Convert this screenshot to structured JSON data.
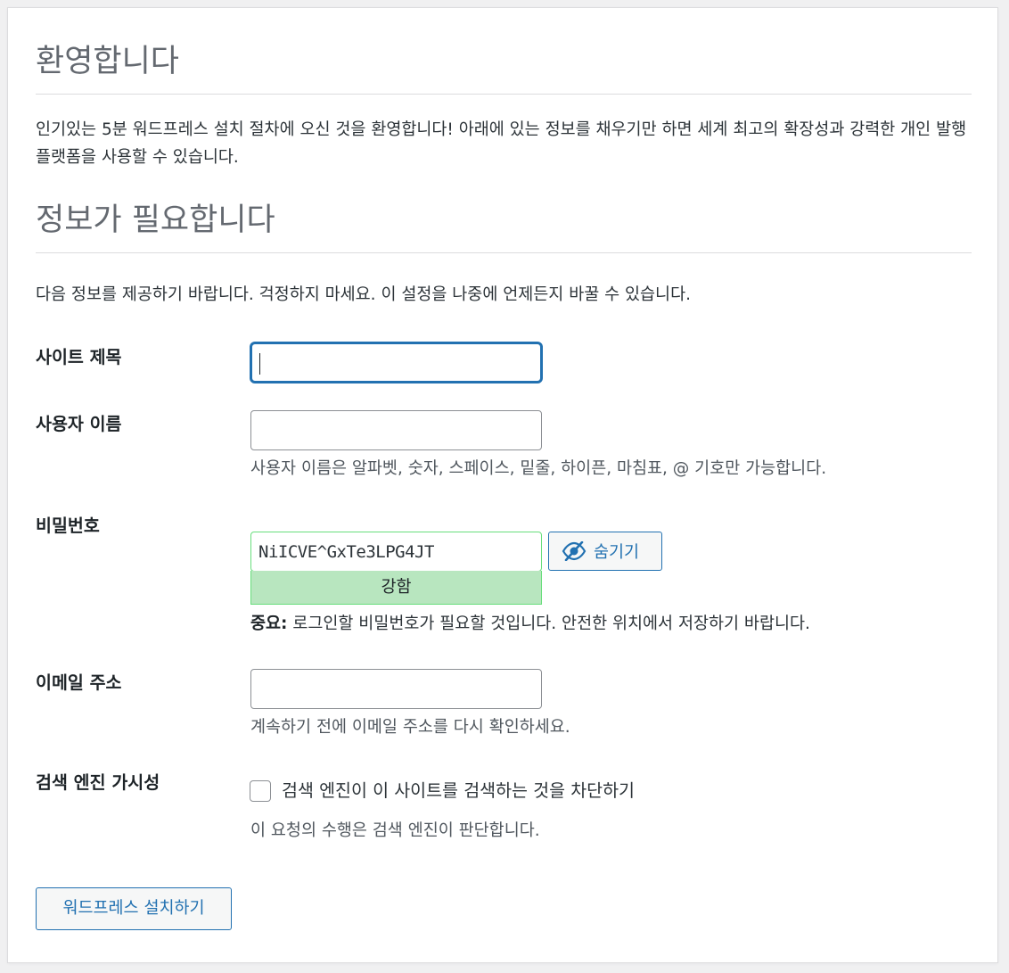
{
  "welcome": {
    "title": "환영합니다",
    "text": "인기있는 5분 워드프레스 설치 절차에 오신 것을 환영합니다! 아래에 있는 정보를 채우기만 하면 세계 최고의 확장성과 강력한 개인 발행 플랫폼을 사용할 수 있습니다."
  },
  "info": {
    "title": "정보가 필요합니다",
    "text": "다음 정보를 제공하기 바랍니다. 걱정하지 마세요. 이 설정을 나중에 언제든지 바꿀 수 있습니다."
  },
  "form": {
    "site_title": {
      "label": "사이트 제목",
      "value": ""
    },
    "username": {
      "label": "사용자 이름",
      "value": "",
      "description": "사용자 이름은 알파벳, 숫자, 스페이스, 밑줄, 하이픈, 마침표, @ 기호만 가능합니다."
    },
    "password": {
      "label": "비밀번호",
      "value": "NiICVE^GxTe3LPG4JT",
      "hide_button_label": "숨기기",
      "strength": "강함",
      "important_prefix": "중요:",
      "important_text": " 로그인할 비밀번호가 필요할 것입니다. 안전한 위치에서 저장하기 바랍니다."
    },
    "email": {
      "label": "이메일 주소",
      "value": "",
      "description": "계속하기 전에 이메일 주소를 다시 확인하세요."
    },
    "search_visibility": {
      "label": "검색 엔진 가시성",
      "checkbox_label": "검색 엔진이 이 사이트를 검색하는 것을 차단하기",
      "checked": false,
      "description": "이 요청의 수행은 검색 엔진이 판단합니다."
    },
    "submit_label": "워드프레스 설치하기"
  },
  "colors": {
    "accent": "#2271b1",
    "strength_strong_bg": "#b8e6bf",
    "strength_strong_border": "#68de7c"
  }
}
